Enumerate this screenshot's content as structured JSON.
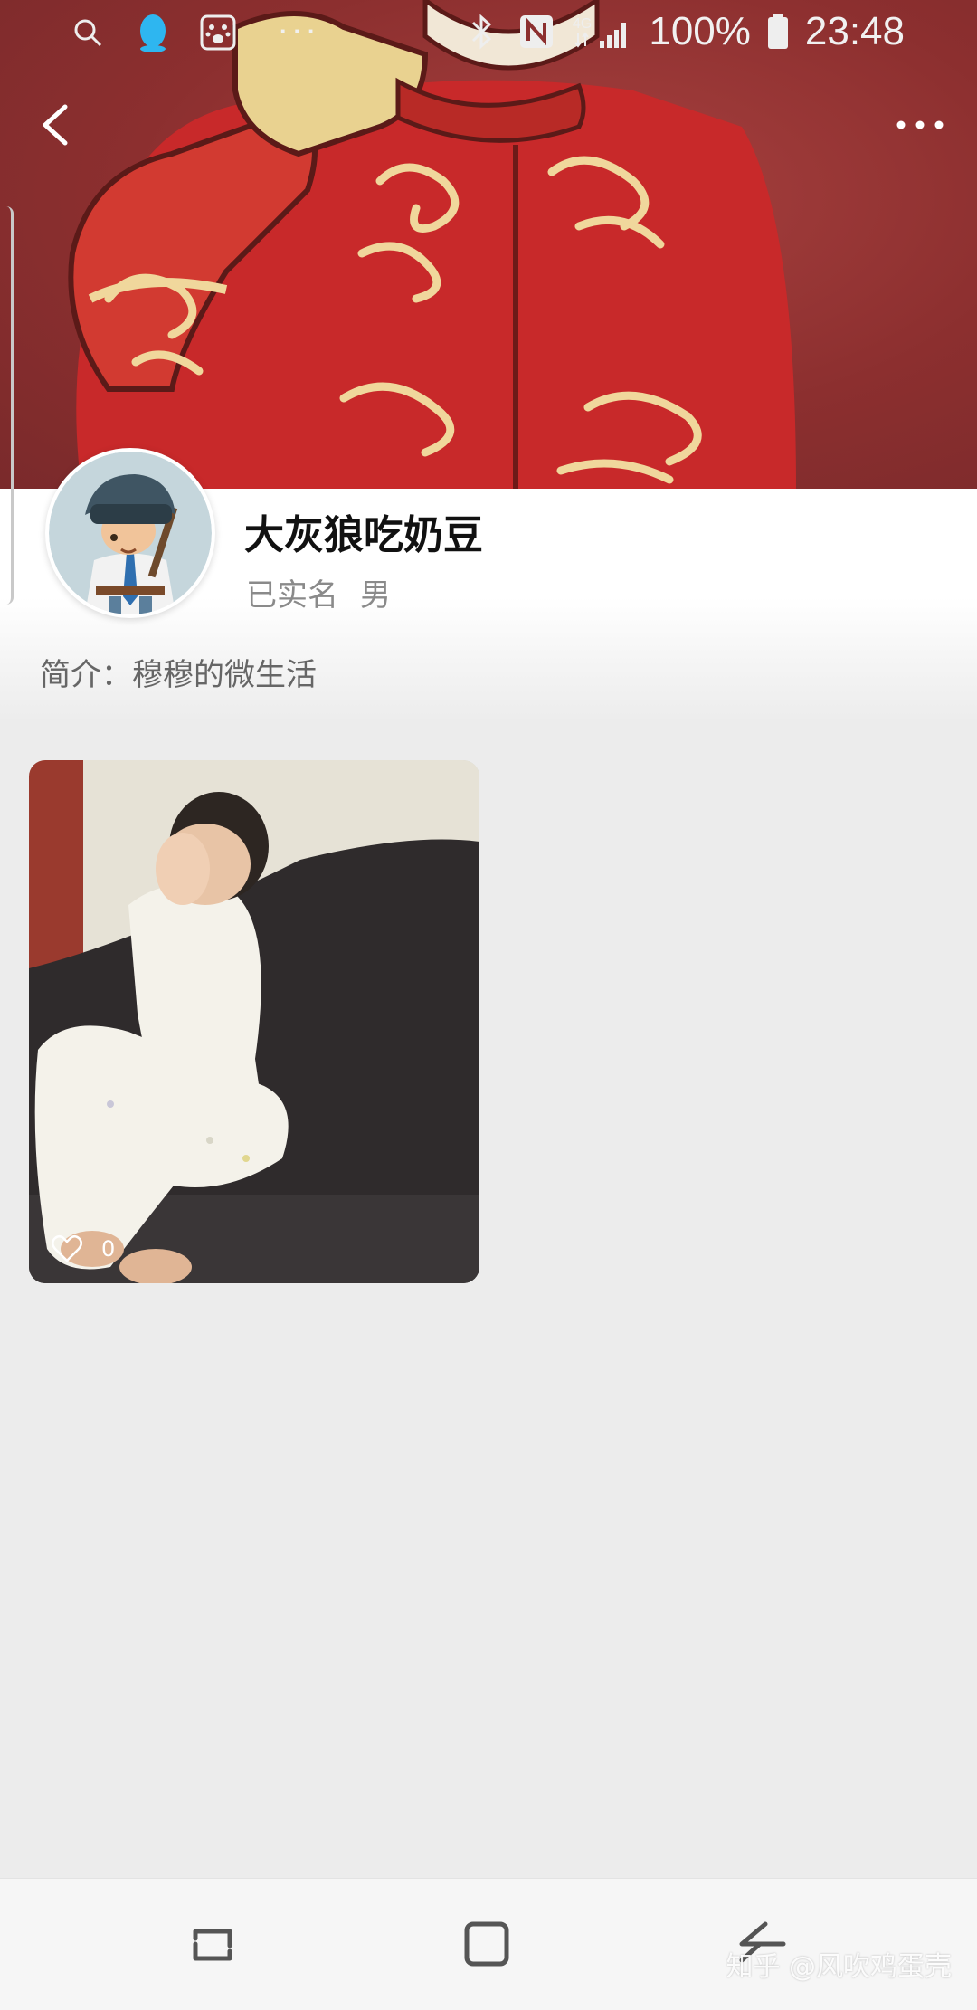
{
  "status_bar": {
    "icons_left": [
      "search-icon",
      "qq-penguin-icon",
      "baidu-paw-icon"
    ],
    "more_notifications": "···",
    "icons_right": [
      "bluetooth-icon",
      "nfc-icon",
      "4g-signal-icon",
      "battery-icon"
    ],
    "network_label": "4G",
    "battery": "100%",
    "time": "23:48"
  },
  "header": {
    "back_icon": "chevron-left-icon",
    "more_icon": "more-dots-icon"
  },
  "profile": {
    "name": "大灰狼吃奶豆",
    "verified": "已实名",
    "gender": "男",
    "bio": "简介：穆穆的微生活"
  },
  "posts": [
    {
      "like_icon": "heart-outline-icon",
      "likes": "0"
    }
  ],
  "nav_bar": {
    "recent_icon": "recent-apps-icon",
    "home_icon": "home-icon",
    "back_icon": "back-icon"
  },
  "watermark": "知乎 @风吹鸡蛋壳",
  "colors": {
    "cover_red": "#8c2f2f",
    "page_bg": "#ececec",
    "name_text": "#111111",
    "meta_text": "#8a8a8a"
  }
}
